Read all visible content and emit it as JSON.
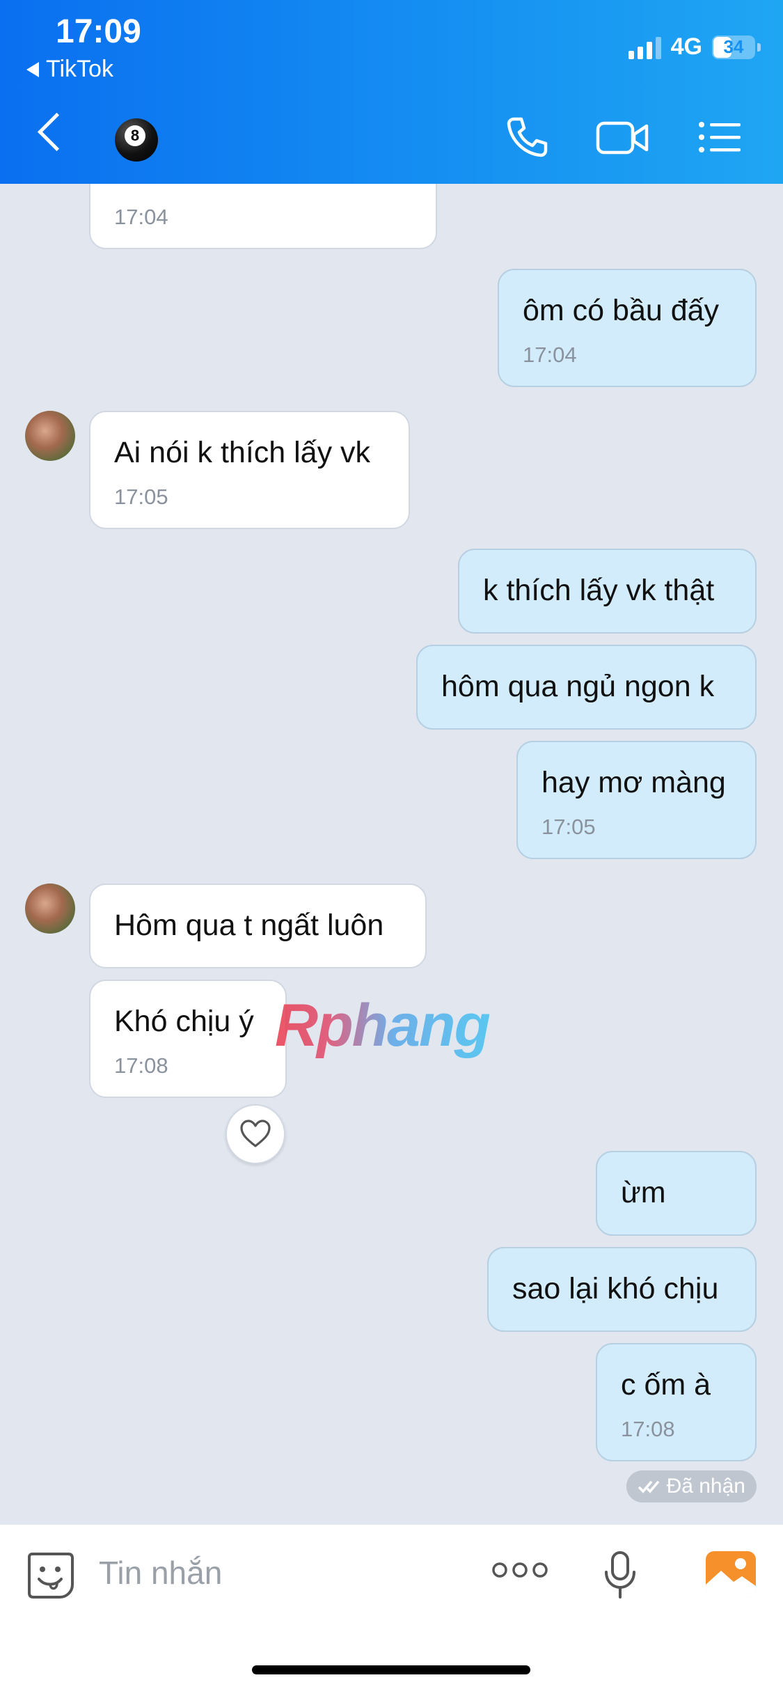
{
  "status_bar": {
    "time": "17:09",
    "back_app": "TikTok",
    "network": "4G",
    "battery": "34"
  },
  "header": {
    "contact_icon": "billiard-ball-8-icon",
    "ball_number": "8"
  },
  "messages": [
    {
      "from": "them",
      "text": "",
      "time": "17:04"
    },
    {
      "from": "me",
      "text": "ôm có bầu đấy",
      "time": "17:04"
    },
    {
      "from": "them",
      "text": "Ai nói k thích lấy vk",
      "time": "17:05"
    },
    {
      "from": "me",
      "text": "k thích lấy vk thật",
      "time": ""
    },
    {
      "from": "me",
      "text": "hôm qua ngủ ngon k",
      "time": ""
    },
    {
      "from": "me",
      "text": "hay mơ màng",
      "time": "17:05"
    },
    {
      "from": "them",
      "text": "Hôm qua t ngất luôn",
      "time": ""
    },
    {
      "from": "them",
      "text": "Khó chịu ý",
      "time": "17:08"
    },
    {
      "from": "me",
      "text": "ừm",
      "time": ""
    },
    {
      "from": "me",
      "text": "sao lại khó chịu",
      "time": ""
    },
    {
      "from": "me",
      "text": "c ốm à",
      "time": "17:08"
    }
  ],
  "status": {
    "delivered": "Đã nhận"
  },
  "watermark": "Rphang",
  "composer": {
    "placeholder": "Tin nhắn"
  },
  "colors": {
    "header": "#1691f2",
    "out_bubble": "#d3ecfb",
    "in_bubble": "#ffffff",
    "chat_bg": "#e2e7ef"
  }
}
